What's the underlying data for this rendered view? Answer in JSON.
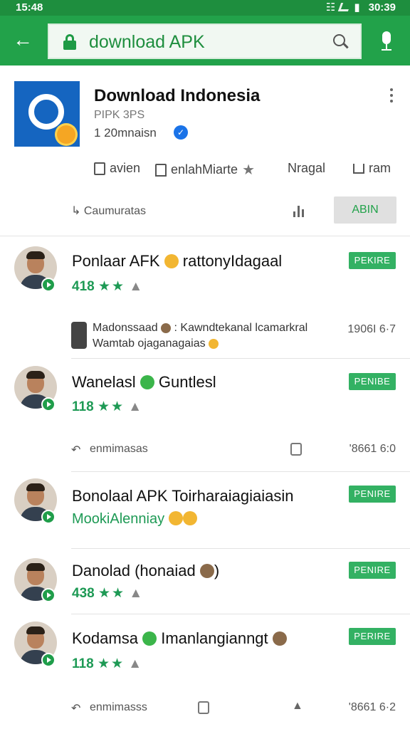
{
  "status_bar": {
    "time": "15:48",
    "clock": "30:39"
  },
  "search": {
    "query": "download APK"
  },
  "app": {
    "title": "Download Indonesia",
    "developer": "PIPK 3PS",
    "installs": "1 20mnaisn",
    "actions": [
      {
        "label": "avien",
        "icon": "square-icon"
      },
      {
        "label": "enlahMiarte",
        "icon": "bookmark-icon"
      },
      {
        "label": "Nragal",
        "icon": ""
      },
      {
        "label": "ram",
        "icon": "share-icon"
      }
    ],
    "caption": "Caumuratas",
    "primary_button": "ABIN"
  },
  "results": [
    {
      "title": "Ponlaar AFK",
      "title_suffix": "rattonyIdagaal",
      "rating": "418",
      "stars": "★★",
      "badge": "PEKIRE"
    },
    {
      "title": "Wanelasl",
      "title_suffix": "Guntlesl",
      "rating": "118",
      "stars": "★★",
      "badge": "PENIBE"
    },
    {
      "title": "Bonolaal APK Toirharaiagiaiasin",
      "subtitle": "MookiAlenniay",
      "badge": "PENIRE"
    },
    {
      "title": "Danolad (honaiad",
      "title_suffix": ")",
      "rating": "438",
      "stars": "★★",
      "badge": "PENIRE"
    },
    {
      "title": "Kodamsa",
      "title_suffix": "Imanlangianngt",
      "rating": "118",
      "stars": "★★",
      "badge": "PERIRE"
    }
  ],
  "message": {
    "line1": "Madonssaad",
    "line1_rest": ": Kawndtekanal lcamarkral",
    "line2": "Wamtab ojaganagaias",
    "count": "1906I 6·7"
  },
  "footers": [
    {
      "text": "enmimasas",
      "count": "'8661 6:0"
    },
    {
      "text": "enmimasss",
      "count": "'8661 6·2"
    }
  ]
}
